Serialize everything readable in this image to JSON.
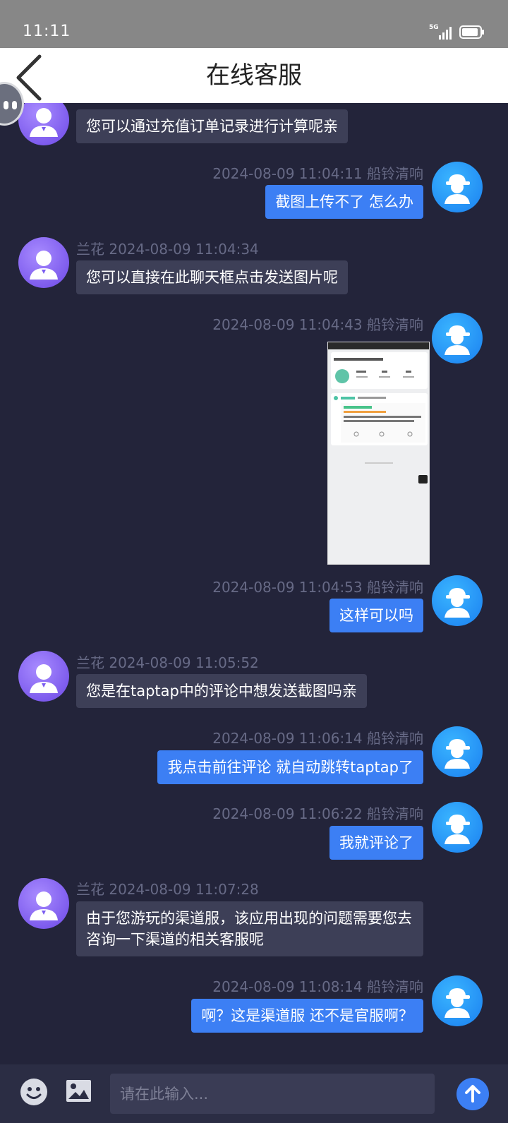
{
  "status_bar": {
    "time": "11:11",
    "network": "5G"
  },
  "header": {
    "title": "在线客服"
  },
  "messages": [
    {
      "role": "agent",
      "meta": "",
      "text": "您可以通过充值订单记录进行计算呢亲"
    },
    {
      "role": "user",
      "meta": "2024-08-09 11:04:11 船铃清响",
      "text": "截图上传不了 怎么办"
    },
    {
      "role": "agent",
      "meta": "兰花 2024-08-09 11:04:34",
      "text": "您可以直接在此聊天框点击发送图片呢"
    },
    {
      "role": "user",
      "meta": "2024-08-09 11:04:43 船铃清响",
      "image": "screenshot-image"
    },
    {
      "role": "user",
      "meta": "2024-08-09 11:04:53 船铃清响",
      "text": "这样可以吗"
    },
    {
      "role": "agent",
      "meta": "兰花 2024-08-09 11:05:52",
      "text": "您是在taptap中的评论中想发送截图吗亲"
    },
    {
      "role": "user",
      "meta": "2024-08-09 11:06:14 船铃清响",
      "text": "我点击前往评论 就自动跳转taptap了"
    },
    {
      "role": "user",
      "meta": "2024-08-09 11:06:22 船铃清响",
      "text": "我就评论了"
    },
    {
      "role": "agent",
      "meta": "兰花 2024-08-09 11:07:28",
      "text": "由于您游玩的渠道服，该应用出现的问题需要您去咨询一下渠道的相关客服呢"
    },
    {
      "role": "user",
      "meta": "2024-08-09 11:08:14 船铃清响",
      "text": "啊？这是渠道服 还不是官服啊？"
    }
  ],
  "input": {
    "placeholder": "请在此输入..."
  },
  "colors": {
    "background": "#23243a",
    "user_bubble": "#3c7ff4",
    "agent_bubble": "#3d3f57",
    "meta_text": "#676a86"
  },
  "icons": {
    "back": "chevron-left-icon",
    "emoji": "emoji-icon",
    "image": "image-icon",
    "send": "arrow-up-icon"
  }
}
